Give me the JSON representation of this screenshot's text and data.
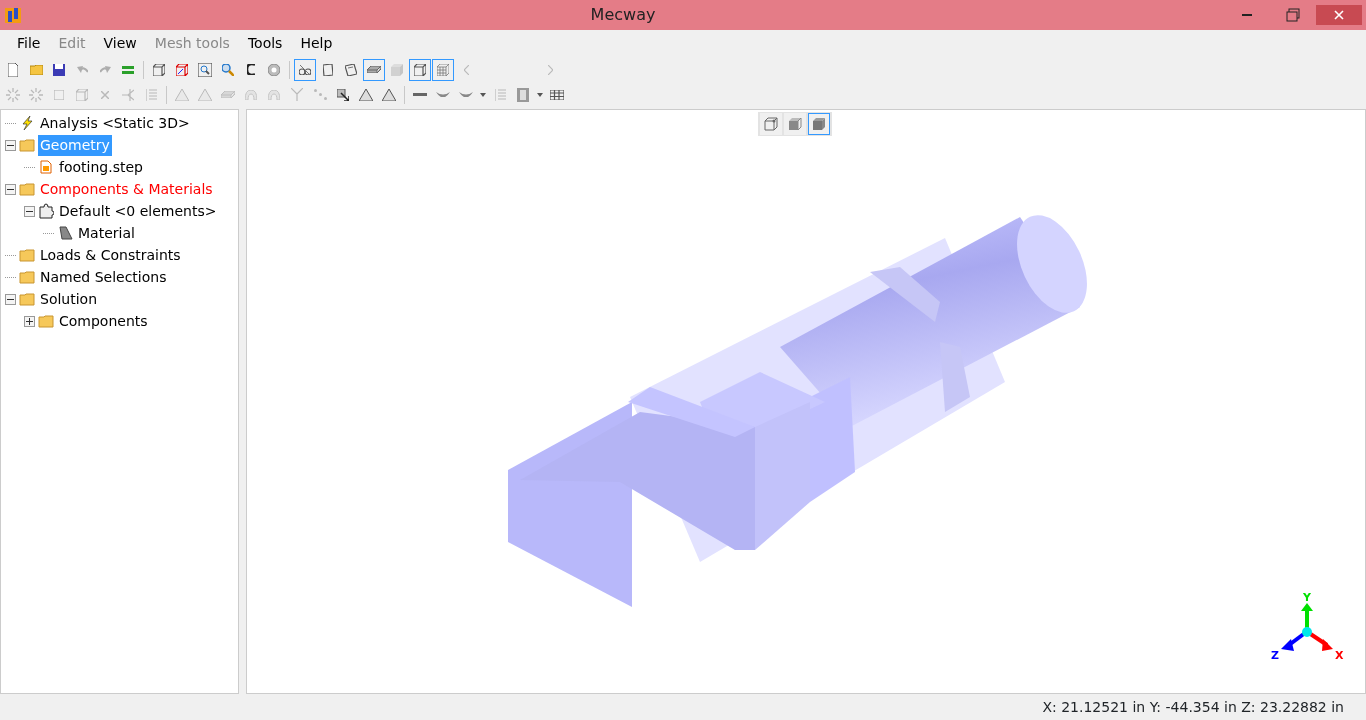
{
  "window": {
    "title": "Mecway"
  },
  "menu": [
    {
      "label": "File",
      "disabled": false
    },
    {
      "label": "Edit",
      "disabled": true
    },
    {
      "label": "View",
      "disabled": false
    },
    {
      "label": "Mesh tools",
      "disabled": true
    },
    {
      "label": "Tools",
      "disabled": false
    },
    {
      "label": "Help",
      "disabled": false
    }
  ],
  "toolbar_1": [
    {
      "kind": "document",
      "pressed": false,
      "disabled": false
    },
    {
      "kind": "folder",
      "pressed": false,
      "disabled": false
    },
    {
      "kind": "floppy-disk",
      "pressed": false,
      "disabled": false
    },
    {
      "kind": "undo",
      "pressed": false,
      "disabled": true
    },
    {
      "kind": "redo",
      "pressed": false,
      "disabled": true
    },
    {
      "kind": "bars",
      "pressed": false,
      "disabled": false
    },
    {
      "kind": "separator"
    },
    {
      "kind": "cube",
      "pressed": false,
      "disabled": false
    },
    {
      "kind": "cube-corner",
      "pressed": false,
      "disabled": false
    },
    {
      "kind": "zoom-box",
      "pressed": false,
      "disabled": false
    },
    {
      "kind": "search",
      "pressed": false,
      "disabled": false
    },
    {
      "kind": "rotate",
      "pressed": false,
      "disabled": false
    },
    {
      "kind": "zoom-circle",
      "pressed": false,
      "disabled": false
    },
    {
      "kind": "separator"
    },
    {
      "kind": "glasses",
      "pressed": true,
      "disabled": false
    },
    {
      "kind": "page",
      "pressed": false,
      "disabled": false
    },
    {
      "kind": "pages",
      "pressed": false,
      "disabled": false
    },
    {
      "kind": "slab",
      "pressed": true,
      "disabled": false
    },
    {
      "kind": "solid-cube",
      "pressed": false,
      "disabled": true
    },
    {
      "kind": "cube",
      "pressed": true,
      "disabled": false
    },
    {
      "kind": "grid-cube",
      "pressed": true,
      "disabled": false
    },
    {
      "kind": "chevron-left",
      "pressed": false,
      "disabled": true
    },
    {
      "kind": "spacer"
    },
    {
      "kind": "chevron-right",
      "pressed": false,
      "disabled": true
    }
  ],
  "toolbar_2": [
    {
      "kind": "starburst",
      "pressed": false,
      "disabled": true
    },
    {
      "kind": "starburst",
      "pressed": false,
      "disabled": true
    },
    {
      "kind": "square",
      "pressed": false,
      "disabled": true
    },
    {
      "kind": "cube",
      "pressed": false,
      "disabled": true
    },
    {
      "kind": "cross",
      "pressed": false,
      "disabled": true
    },
    {
      "kind": "split",
      "pressed": false,
      "disabled": true
    },
    {
      "kind": "columns",
      "pressed": false,
      "disabled": true
    },
    {
      "kind": "separator"
    },
    {
      "kind": "triangle",
      "pressed": false,
      "disabled": true
    },
    {
      "kind": "triangle",
      "pressed": false,
      "disabled": true
    },
    {
      "kind": "slab",
      "pressed": false,
      "disabled": true
    },
    {
      "kind": "arch",
      "pressed": false,
      "disabled": true
    },
    {
      "kind": "arch",
      "pressed": false,
      "disabled": true
    },
    {
      "kind": "branch",
      "pressed": false,
      "disabled": true
    },
    {
      "kind": "dots",
      "pressed": false,
      "disabled": true
    },
    {
      "kind": "arrow",
      "pressed": false,
      "disabled": false
    },
    {
      "kind": "triangle",
      "pressed": false,
      "disabled": false
    },
    {
      "kind": "triangle",
      "pressed": false,
      "disabled": false
    },
    {
      "kind": "separator"
    },
    {
      "kind": "line",
      "pressed": false,
      "disabled": false
    },
    {
      "kind": "bowl",
      "pressed": false,
      "disabled": false
    },
    {
      "kind": "bowl",
      "pressed": false,
      "disabled": false
    },
    {
      "kind": "caret",
      "pressed": false,
      "disabled": false
    },
    {
      "kind": "columns",
      "pressed": false,
      "disabled": true
    },
    {
      "kind": "film",
      "pressed": false,
      "disabled": false
    },
    {
      "kind": "caret",
      "pressed": false,
      "disabled": false
    },
    {
      "kind": "table",
      "pressed": false,
      "disabled": false
    }
  ],
  "tree": [
    {
      "label": "Analysis <Static 3D>",
      "selected": false,
      "warning": false
    },
    {
      "label": "Geometry",
      "selected": true,
      "warning": false,
      "expanded": true,
      "children": [
        {
          "label": "footing.step",
          "selected": false,
          "warning": false
        }
      ]
    },
    {
      "label": "Components & Materials",
      "selected": false,
      "warning": true,
      "expanded": true,
      "children": [
        {
          "label": "Default <0 elements>",
          "selected": false,
          "warning": false,
          "expanded": true,
          "children": [
            {
              "label": "Material",
              "selected": false,
              "warning": false
            }
          ]
        }
      ]
    },
    {
      "label": "Loads & Constraints",
      "selected": false,
      "warning": false
    },
    {
      "label": "Named Selections",
      "selected": false,
      "warning": false
    },
    {
      "label": "Solution",
      "selected": false,
      "warning": false,
      "expanded": true,
      "children": [
        {
          "label": "Components",
          "selected": false,
          "warning": false,
          "expanded": false
        }
      ]
    }
  ],
  "view_modes": [
    {
      "kind": "wireframe",
      "selected": false
    },
    {
      "kind": "shaded",
      "selected": false
    },
    {
      "kind": "solid",
      "selected": true
    }
  ],
  "axes": {
    "x": "X",
    "y": "Y",
    "z": "Z"
  },
  "status_bar": {
    "coordinates": "X: 21.12521 in Y: -44.354 in Z: 23.22882 in"
  }
}
